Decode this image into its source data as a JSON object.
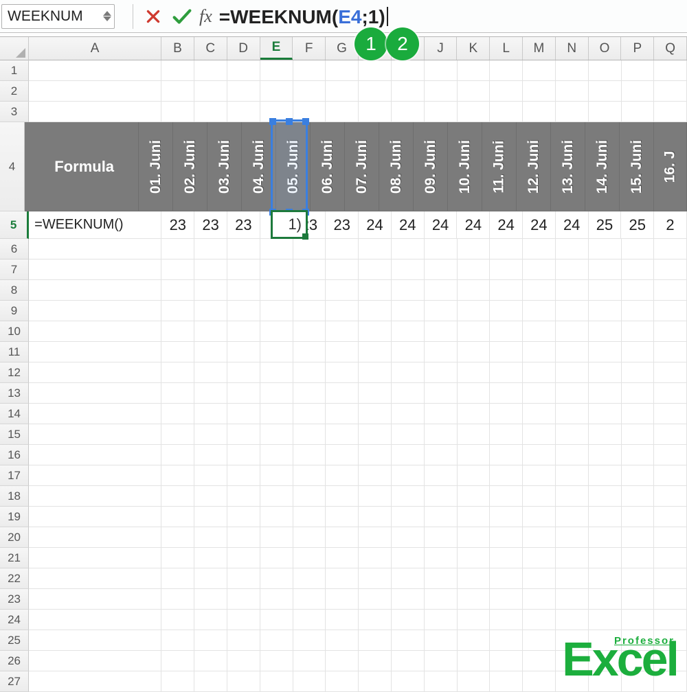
{
  "nameBox": "WEEKNUM",
  "formula": {
    "prefix": "=WEEKNUM(",
    "ref": "E4",
    "suffix": ";1)"
  },
  "fx_label": "fx",
  "columns": [
    "A",
    "B",
    "C",
    "D",
    "E",
    "F",
    "G",
    "H",
    "I",
    "J",
    "K",
    "L",
    "M",
    "N",
    "O",
    "P",
    "Q"
  ],
  "active_column": "E",
  "row_numbers": [
    1,
    2,
    3,
    4,
    5,
    6,
    7,
    8,
    9,
    10,
    11,
    12,
    13,
    14,
    15,
    16,
    17,
    18,
    19,
    20,
    21,
    22,
    23,
    24,
    25,
    26,
    27
  ],
  "active_row": 5,
  "row4": {
    "label": "Formula",
    "dates": [
      "01. Juni",
      "02. Juni",
      "03. Juni",
      "04. Juni",
      "05. Juni",
      "06. Juni",
      "07. Juni",
      "08. Juni",
      "09. Juni",
      "10. Juni",
      "11. Juni",
      "12. Juni",
      "13. Juni",
      "14. Juni",
      "15. Juni",
      "16. J"
    ]
  },
  "row5": {
    "label": "=WEEKNUM()",
    "values": [
      "23",
      "23",
      "23",
      "1)",
      "23",
      "23",
      "24",
      "24",
      "24",
      "24",
      "24",
      "24",
      "24",
      "25",
      "25",
      "2"
    ]
  },
  "active_cell_display": "1)",
  "annotations": {
    "c1": "1",
    "c2": "2"
  },
  "logo": {
    "main": "Excel",
    "sub": "Professor"
  }
}
